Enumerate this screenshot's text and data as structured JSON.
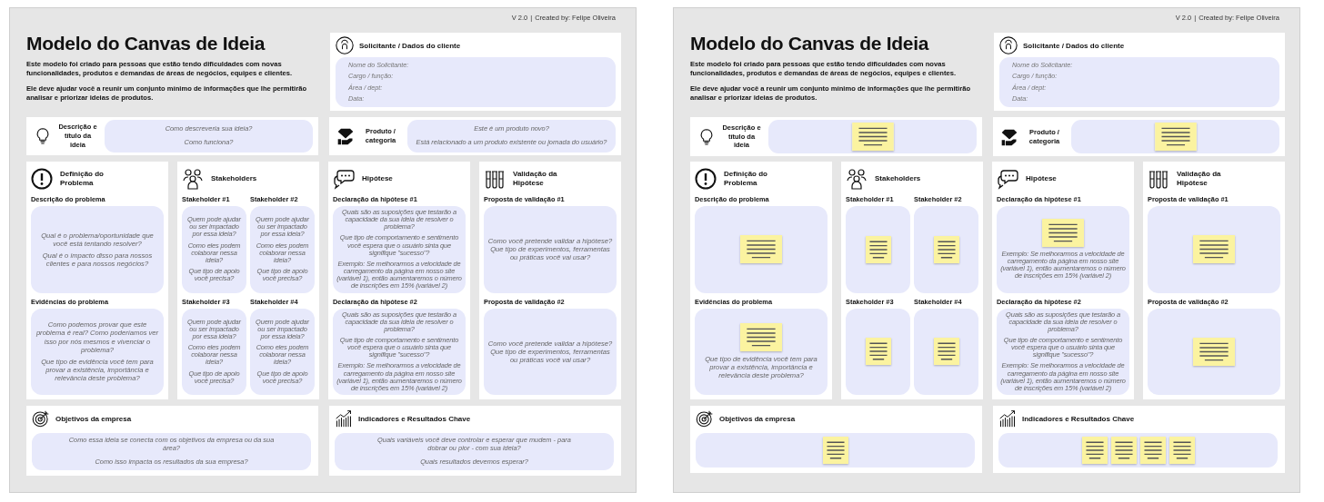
{
  "boards": [
    {
      "version": "V 2.0",
      "separator": "|",
      "credit": "Created by: Felipe Oliveira",
      "title": "Modelo do Canvas de Ideia",
      "intro": [
        "Este modelo foi criado para pessoas que estão tendo dificuldades com novas funcionalidades, produtos e demandas de áreas de negócios, equipes e clientes.",
        "Ele deve ajudar você a reunir um conjunto mínimo de informações que lhe permitirão analisar e priorizar ideias de produtos."
      ],
      "client": {
        "title": "Solicitante / Dados do cliente",
        "fields": [
          "Nome do Solicitante:",
          "Cargo / função:",
          "Área / dept:",
          "Data:"
        ]
      },
      "row": [
        {
          "kind": "idea",
          "title": "Descrição e título da ideia",
          "prompts": [
            "Como descreveria sua ideia?",
            "Como funciona?"
          ]
        },
        {
          "kind": "product",
          "title": "Produto / categoria",
          "prompts": [
            "Este é um produto novo?",
            "Está relacionado a um produto existente ou jornada do usuário?"
          ]
        }
      ],
      "columns": [
        {
          "kind": "problem",
          "title": "Definição do Problema",
          "blocks": [
            {
              "label": "Descrição do problema",
              "prompts": [
                "Qual é o problema/oportunidade que você está tentando resolver?",
                "Qual é o impacto disso para nossos clientes e para nossos negócios?"
              ]
            },
            {
              "label": "Evidências do problema",
              "prompts": [
                "Como podemos provar que este problema é real? Como poderíamos ver isso por nós mesmos e vivenciar o problema?",
                "Que tipo de evidência você tem para provar a existência, importância e relevância deste problema?"
              ]
            }
          ]
        },
        {
          "kind": "stakeholders",
          "title": "Stakeholders",
          "blocks": [
            {
              "label": "Stakeholder #1",
              "prompts": [
                "Quem pode ajudar ou ser impactado por essa ideia?",
                "Como eles podem colaborar nessa ideia?",
                "Que tipo de apoio você precisa?"
              ]
            },
            {
              "label": "Stakeholder #2",
              "prompts": [
                "Quem pode ajudar ou ser impactado por essa ideia?",
                "Como eles podem colaborar nessa ideia?",
                "Que tipo de apoio você precisa?"
              ]
            },
            {
              "label": "Stakeholder #3",
              "prompts": [
                "Quem pode ajudar ou ser impactado por essa ideia?",
                "Como eles podem colaborar nessa ideia?",
                "Que tipo de apoio você precisa?"
              ]
            },
            {
              "label": "Stakeholder #4",
              "prompts": [
                "Quem pode ajudar ou ser impactado por essa ideia?",
                "Como eles podem colaborar nessa ideia?",
                "Que tipo de apoio você precisa?"
              ]
            }
          ]
        },
        {
          "kind": "hypothesis",
          "title": "Hipótese",
          "blocks": [
            {
              "label": "Declaração da hipótese #1",
              "prompts": [
                "Quais são as suposições que testarão a capacidade da sua ideia de resolver o problema?",
                "Que tipo de comportamento e sentimento você espera que o usuário sinta que signifique \"sucesso\"?",
                "Exemplo: Se melhorarmos a velocidade de carregamento da página em nosso site (variável 1), então aumentaremos o número de inscrições em 15% (variável 2)"
              ]
            },
            {
              "label": "Declaração da hipótese #2",
              "prompts": [
                "Quais são as suposições que testarão a capacidade da sua ideia de resolver o problema?",
                "Que tipo de comportamento e sentimento você espera que o usuário sinta que signifique \"sucesso\"?",
                "Exemplo: Se melhorarmos a velocidade de carregamento da página em nosso site (variável 1), então aumentaremos o número de inscrições em 15% (variável 2)"
              ]
            }
          ]
        },
        {
          "kind": "validation",
          "title": "Validação da Hipótese",
          "blocks": [
            {
              "label": "Proposta de validação #1",
              "prompts": [
                "Como você pretende validar a hipótese? Que tipo de experimentos, ferramentas ou práticas você vai usar?"
              ]
            },
            {
              "label": "Proposta de validação #2",
              "prompts": [
                "Como você pretende validar a hipótese? Que tipo de experimentos, ferramentas ou práticas você vai usar?"
              ]
            }
          ]
        }
      ],
      "bottom": [
        {
          "kind": "target",
          "title": "Objetivos da empresa",
          "prompts": [
            "Como essa ideia se conecta com os objetivos da empresa ou da sua área?",
            "Como isso impacta os resultados da sua empresa?"
          ]
        },
        {
          "kind": "chart",
          "title": "Indicadores e Resultados Chave",
          "prompts": [
            "Quais variáveis você deve controlar e esperar que mudem - para dobrar ou pior - com sua ideia?",
            "Quais resultados devemos esperar?"
          ]
        }
      ]
    },
    {
      "version": "V 2.0",
      "separator": "|",
      "credit": "Created by: Felipe Oliveira",
      "title": "Modelo do Canvas de Ideia",
      "intro": [
        "Este modelo foi criado para pessoas que estão tendo dificuldades com novas funcionalidades, produtos e demandas de áreas de negócios, equipes e clientes.",
        "Ele deve ajudar você a reunir um conjunto mínimo de informações que lhe permitirão analisar e priorizar ideias de produtos."
      ],
      "client": {
        "title": "Solicitante / Dados do cliente",
        "fields": [
          "Nome do Solicitante:",
          "Cargo / função:",
          "Área / dept:",
          "Data:"
        ]
      },
      "row": [
        {
          "kind": "idea",
          "title": "Descrição e título da ideia",
          "notes": [
            {
              "kind": "sticky"
            }
          ]
        },
        {
          "kind": "product",
          "title": "Produto / categoria",
          "notes": [
            {
              "kind": "sticky"
            }
          ]
        }
      ],
      "columns": [
        {
          "kind": "problem",
          "title": "Definição do Problema",
          "blocks": [
            {
              "label": "Descrição do problema",
              "notes": [
                {
                  "kind": "sticky"
                }
              ]
            },
            {
              "label": "Evidências do problema",
              "prompts": [
                "Que tipo de evidência você tem para provar a existência, importância e relevância deste problema?"
              ],
              "notes": [
                {
                  "kind": "sticky"
                }
              ]
            }
          ]
        },
        {
          "kind": "stakeholders",
          "title": "Stakeholders",
          "blocks": [
            {
              "label": "Stakeholder #1",
              "notes": [
                {
                  "kind": "sticky"
                }
              ]
            },
            {
              "label": "Stakeholder #2",
              "notes": [
                {
                  "kind": "sticky"
                }
              ]
            },
            {
              "label": "Stakeholder #3",
              "notes": [
                {
                  "kind": "sticky"
                }
              ]
            },
            {
              "label": "Stakeholder #4",
              "notes": [
                {
                  "kind": "sticky"
                }
              ]
            }
          ]
        },
        {
          "kind": "hypothesis",
          "title": "Hipótese",
          "blocks": [
            {
              "label": "Declaração da hipótese #1",
              "prompts": [
                "Exemplo: Se melhorarmos a velocidade de carregamento da página em nosso site (variável 1), então aumentaremos o número de inscrições em 15% (variável 2)"
              ],
              "notes": [
                {
                  "kind": "sticky"
                }
              ]
            },
            {
              "label": "Declaração da hipótese #2",
              "prompts": [
                "Quais são as suposições que testarão a capacidade da sua ideia de resolver o problema?",
                "Que tipo de comportamento e sentimento você espera que o usuário sinta que signifique \"sucesso\"?",
                "Exemplo: Se melhorarmos a velocidade de carregamento da página em nosso site (variável 1), então aumentaremos o número de inscrições em 15% (variável 2)"
              ]
            }
          ]
        },
        {
          "kind": "validation",
          "title": "Validação da Hipótese",
          "blocks": [
            {
              "label": "Proposta de validação #1",
              "notes": [
                {
                  "kind": "sticky"
                }
              ]
            },
            {
              "label": "Proposta de validação #2",
              "notes": [
                {
                  "kind": "sticky"
                }
              ]
            }
          ]
        }
      ],
      "bottom": [
        {
          "kind": "target",
          "title": "Objetivos da empresa",
          "notes": [
            {
              "kind": "sticky"
            }
          ]
        },
        {
          "kind": "chart",
          "title": "Indicadores e Resultados Chave",
          "notes": [
            {
              "kind": "sticky"
            },
            {
              "kind": "sticky"
            },
            {
              "kind": "sticky"
            },
            {
              "kind": "sticky"
            }
          ]
        }
      ]
    }
  ]
}
